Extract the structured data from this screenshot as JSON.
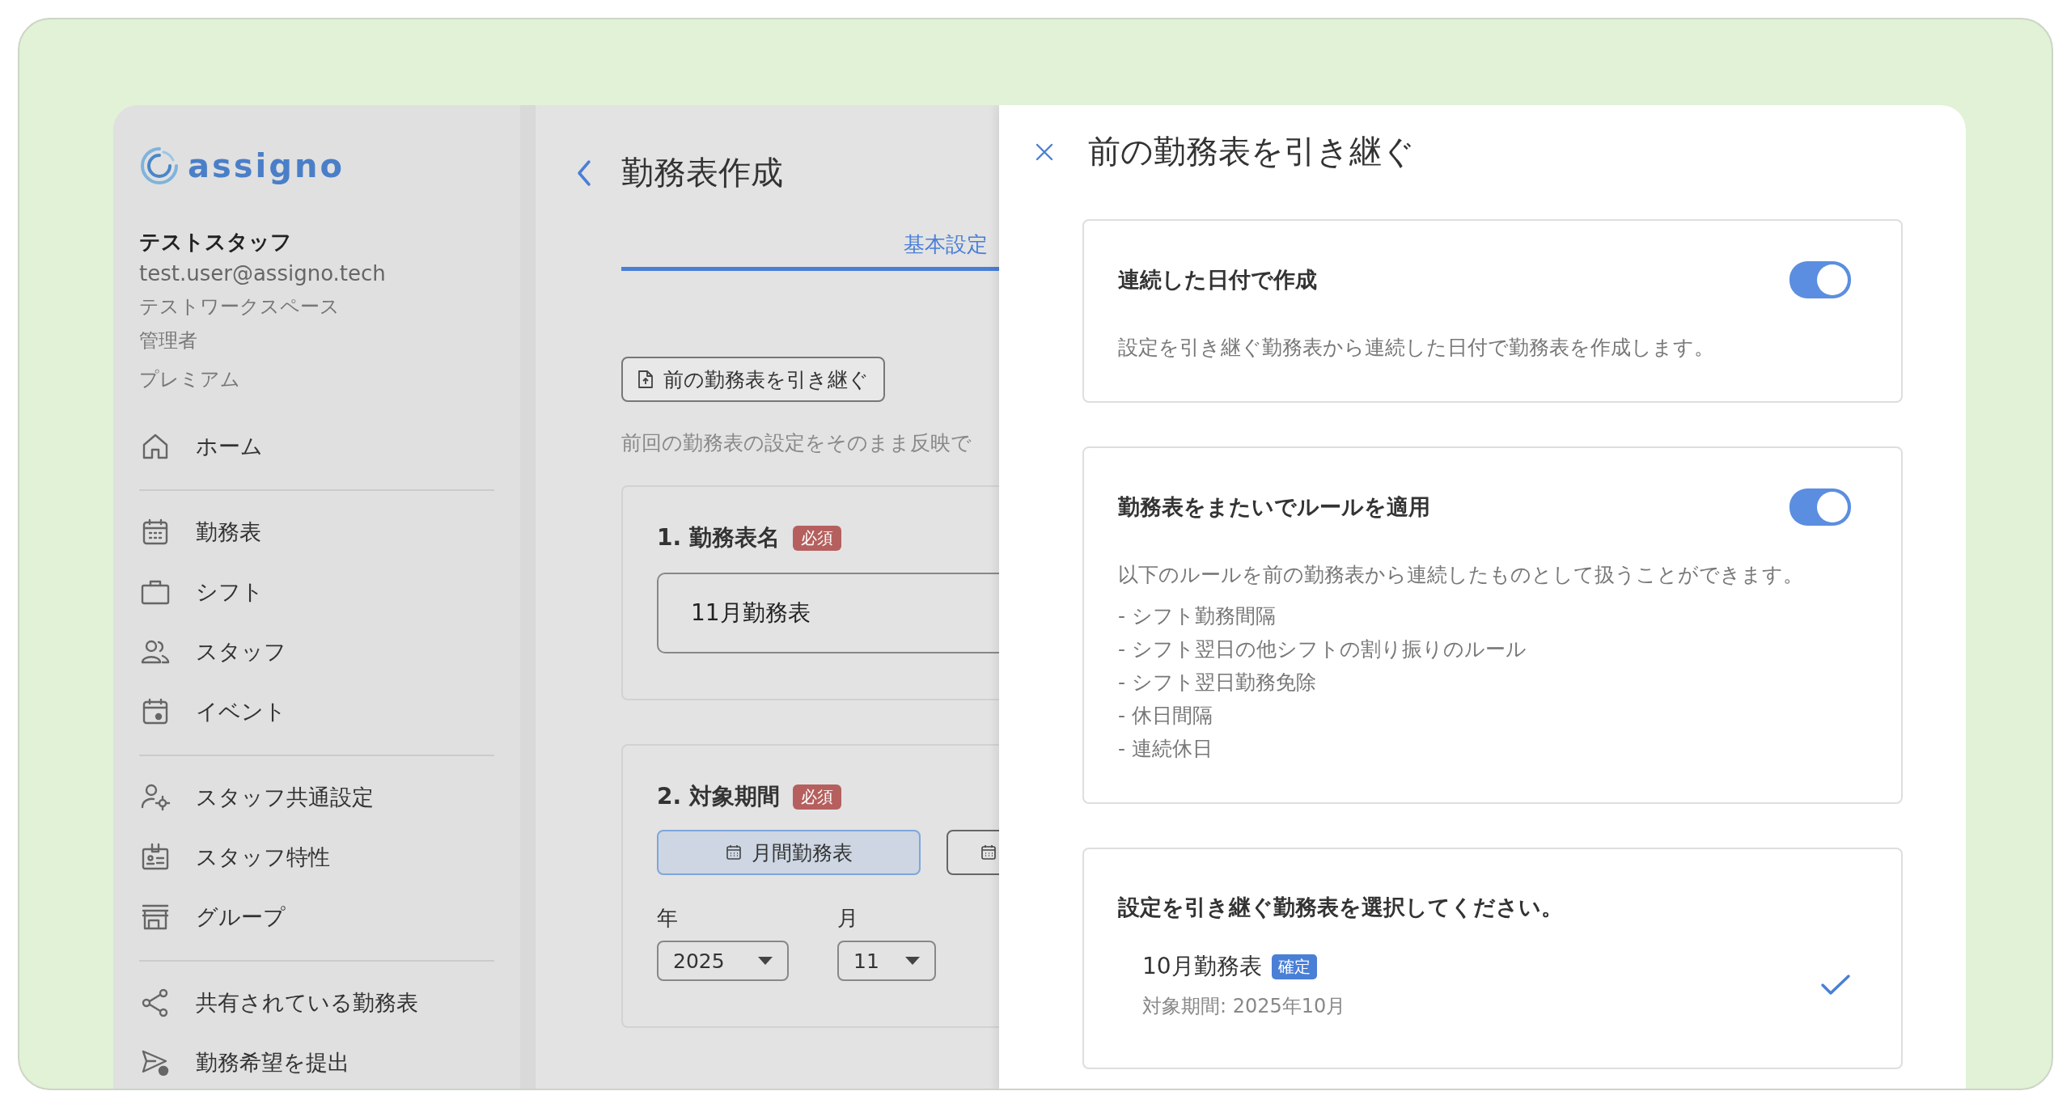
{
  "sidebar": {
    "logo": "assigno",
    "user": {
      "name": "テストスタッフ",
      "email": "test.user@assigno.tech",
      "workspace": "テストワークスペース",
      "role": "管理者",
      "plan": "プレミアム"
    },
    "nav_groups": [
      {
        "items": [
          {
            "label": "ホーム"
          }
        ]
      },
      {
        "items": [
          {
            "label": "勤務表"
          },
          {
            "label": "シフト"
          },
          {
            "label": "スタッフ"
          },
          {
            "label": "イベント"
          }
        ]
      },
      {
        "items": [
          {
            "label": "スタッフ共通設定"
          },
          {
            "label": "スタッフ特性"
          },
          {
            "label": "グループ"
          }
        ]
      },
      {
        "items": [
          {
            "label": "共有されている勤務表"
          },
          {
            "label": "勤務希望を提出"
          }
        ]
      }
    ]
  },
  "main": {
    "title": "勤務表作成",
    "tabs": [
      {
        "label": "基本設定",
        "selected": true
      }
    ],
    "import_button": "前の勤務表を引き継ぐ",
    "description": "前回の勤務表の設定をそのまま反映で",
    "sections": [
      {
        "kind": "name",
        "title": "1. 勤務表名",
        "badge": "必須",
        "value": "11月勤務表"
      },
      {
        "kind": "period",
        "title": "2. 対象期間",
        "badge": "必須",
        "period_types": [
          {
            "label": "月間勤務表",
            "selected": true
          },
          {
            "selected": false
          }
        ],
        "selects": [
          {
            "label": "年",
            "value": "2025"
          },
          {
            "label": "月",
            "value": "11"
          }
        ]
      }
    ]
  },
  "drawer": {
    "title": "前の勤務表を引き継ぐ",
    "options": [
      {
        "title": "連続した日付で作成",
        "on": true,
        "description": "設定を引き継ぐ勤務表から連続した日付で勤務表を作成します。"
      },
      {
        "title": "勤務表をまたいでルールを適用",
        "on": true,
        "description": "以下のルールを前の勤務表から連続したものとして扱うことができます。",
        "rules": [
          "- シフト勤務間隔",
          "- シフト翌日の他シフトの割り振りのルール",
          "- シフト翌日勤務免除",
          "- 休日間隔",
          "- 連続休日"
        ]
      }
    ],
    "selection": {
      "prompt": "設定を引き継ぐ勤務表を選択してください。",
      "items": [
        {
          "name": "10月勤務表",
          "badge": "確定",
          "period": "対象期間: 2025年10月",
          "selected": true
        }
      ]
    }
  }
}
